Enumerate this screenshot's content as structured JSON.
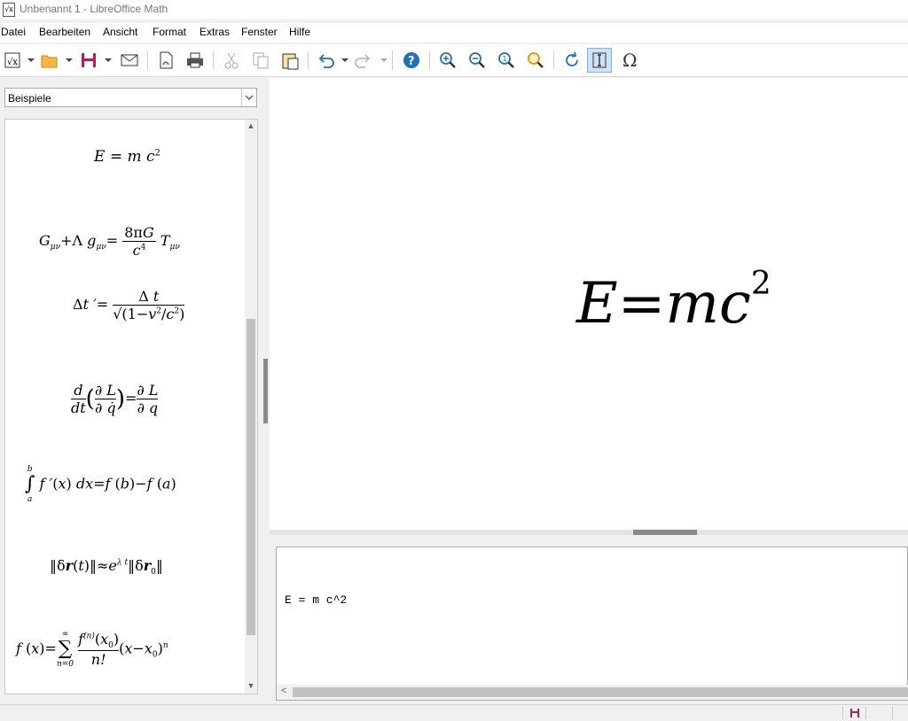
{
  "window": {
    "title": "Unbenannt 1 - LibreOffice Math",
    "app_icon": "libreoffice-math-icon"
  },
  "menu": [
    "Datei",
    "Bearbeiten",
    "Ansicht",
    "Format",
    "Extras",
    "Fenster",
    "Hilfe"
  ],
  "toolbar": {
    "icons": [
      "new-formula-icon",
      "open-icon",
      "save-icon",
      "email-icon",
      "export-pdf-icon",
      "print-icon",
      "cut-icon",
      "copy-icon",
      "paste-icon",
      "undo-icon",
      "redo-icon",
      "help-icon",
      "zoom-in-icon",
      "zoom-out-icon",
      "zoom-100-icon",
      "show-all-icon",
      "update-icon",
      "formula-cursor-icon",
      "symbols-icon"
    ]
  },
  "elements_panel": {
    "selected_category": "Beispiele",
    "examples": [
      "E = m c^2",
      "G_{μν} + Λ g_{μν} = (8πG / c^4) T_{μν}",
      "Δt' = Δt / sqrt(1 - v^2/c^2)",
      "d/dt (∂L/∂q̇) = ∂L/∂q",
      "∫_a^b f'(x) dx = f(b) - f(a)",
      "||δ r(t)|| ≈ e^{λ t} ||δ r_0||",
      "f(x) = Σ_{n=0}^{∞} (f^{(n)}(x_0) / n!) (x - x_0)^n"
    ]
  },
  "formula": {
    "base": "E=mc",
    "exponent": "2"
  },
  "command_text": "E = m c^2",
  "statusbar": {
    "icons": [
      "document-modified-icon"
    ]
  }
}
